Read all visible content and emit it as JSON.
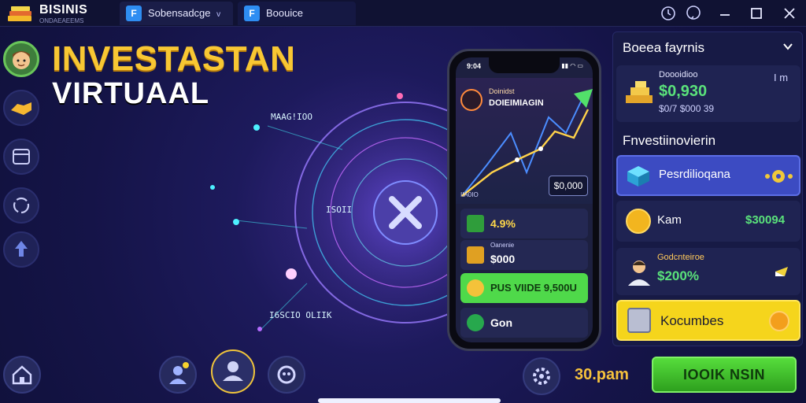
{
  "brand": {
    "name": "BISINIS",
    "sub": "ONDAEAEEMS"
  },
  "tabs": [
    {
      "icon_text": "F",
      "label": "Sobensadcge",
      "caret": "v"
    },
    {
      "icon_text": "F",
      "label": "Boouice"
    }
  ],
  "window_controls": [
    "history-icon",
    "chat-icon",
    "minimize-icon",
    "maximize-icon",
    "close-icon"
  ],
  "title": {
    "line1": "INVESTASTAN",
    "line2": "VIRTUAAL"
  },
  "rail": [
    "avatar",
    "handshake-icon",
    "card-icon",
    "refresh-icon",
    "upload-icon"
  ],
  "dial_labels": {
    "top": "MAAG!IOO",
    "mid": "ISOII",
    "bottom": "I6SCIO OLIIK"
  },
  "phone": {
    "status_time": "9:04",
    "head_line1": "Doinidst",
    "head_line2": "DOIEIMIAGIN",
    "badge": "$0,000",
    "tick": "IIA0IO",
    "rows": [
      {
        "label": "",
        "value": "4.9%",
        "icon": "cash-icon"
      },
      {
        "label": "Oanenie",
        "value": "$000",
        "icon": "gold-bars-icon"
      },
      {
        "label": "",
        "value": "PUS VIIDE 9,500U",
        "icon": "coin-icon"
      },
      {
        "label": "",
        "value": "Gon",
        "icon": "dollar-icon"
      }
    ]
  },
  "right_panel": {
    "header": "Boeea fayrnis",
    "summary": {
      "label": "Doooidioo",
      "value": "$0,930",
      "sub": "$0/7 $000 39",
      "unit": "I m"
    },
    "section_title": "Fnvestiinovierin",
    "items": [
      {
        "label": "Pesrdilioqana",
        "value": "",
        "icon": "cube-icon",
        "style": "blue"
      },
      {
        "label": "Kam",
        "value": "$30094",
        "icon": "coin-icon",
        "style": "dark"
      },
      {
        "label": "Godcnteiroe",
        "value": "$200%",
        "icon": "person-icon",
        "style": "dark"
      },
      {
        "label": "Kocumbes",
        "value": "",
        "icon": "box-icon",
        "style": "yellow"
      }
    ]
  },
  "bottom": {
    "time": "30.pam",
    "join_label": "IOOIK NSIN"
  }
}
